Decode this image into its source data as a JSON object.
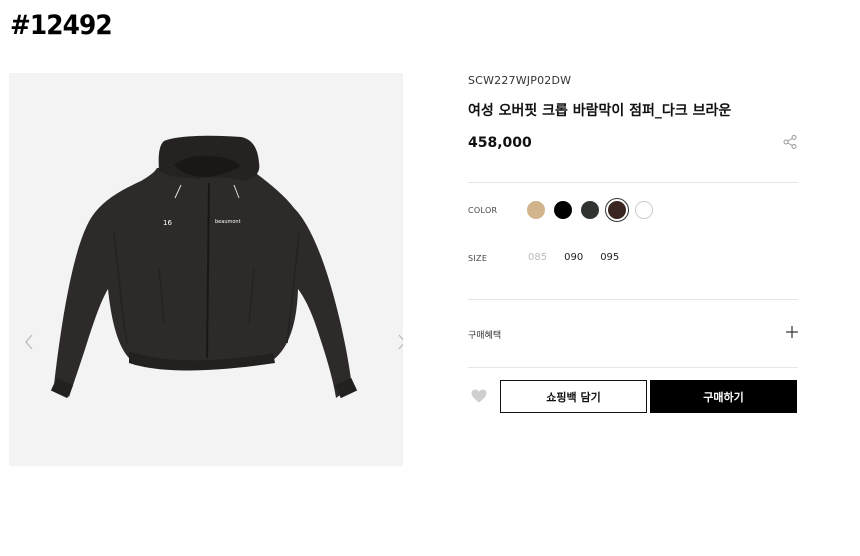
{
  "listing_id": "#12492",
  "product": {
    "sku": "SCW227WJP02DW",
    "title": "여성 오버핏 크롭 바람막이 점퍼_다크 브라운",
    "price": "458,000",
    "image_texts": {
      "number": "16",
      "brand": "beaumont"
    }
  },
  "options": {
    "color_label": "COLOR",
    "colors": [
      {
        "name": "beige",
        "hex": "#d2b48c",
        "selected": false
      },
      {
        "name": "black",
        "hex": "#000000",
        "selected": false
      },
      {
        "name": "dark-green",
        "hex": "#2f3430",
        "selected": false
      },
      {
        "name": "dark-brown",
        "hex": "#3a2620",
        "selected": true
      },
      {
        "name": "white",
        "hex": "#ffffff",
        "selected": false
      }
    ],
    "size_label": "SIZE",
    "sizes": [
      {
        "label": "085",
        "disabled": true
      },
      {
        "label": "090",
        "disabled": false
      },
      {
        "label": "095",
        "disabled": false
      }
    ]
  },
  "benefit": {
    "label": "구매혜택"
  },
  "actions": {
    "bag_label": "쇼핑백 담기",
    "buy_label": "구매하기"
  },
  "icons": {
    "share": "share-icon",
    "plus": "plus-icon",
    "wish": "heart-icon",
    "prev": "chevron-left-icon",
    "next": "chevron-right-icon"
  }
}
